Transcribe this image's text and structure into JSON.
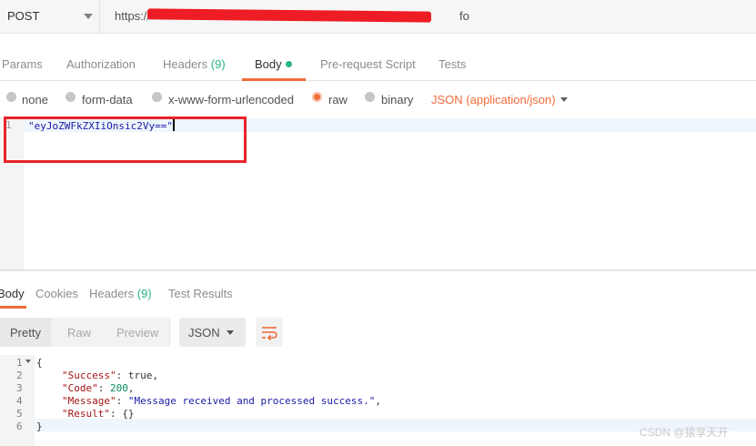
{
  "request": {
    "method": "POST",
    "url_visible": "https://",
    "url_tail": "fo"
  },
  "request_tabs": [
    {
      "label": "Params"
    },
    {
      "label": "Authorization"
    },
    {
      "label": "Headers",
      "count": "(9)"
    },
    {
      "label": "Body",
      "active": true
    },
    {
      "label": "Pre-request Script"
    },
    {
      "label": "Tests"
    }
  ],
  "body_options": {
    "none": "none",
    "form_data": "form-data",
    "urlencoded": "x-www-form-urlencoded",
    "raw": "raw",
    "binary": "binary",
    "selected": "raw",
    "content_type": "JSON (application/json)"
  },
  "request_body": {
    "line_number": "1",
    "text": "\"eyJoZWFkZXIiOnsic2Vy==\""
  },
  "response_tabs": [
    {
      "label": "Body",
      "active": true
    },
    {
      "label": "Cookies"
    },
    {
      "label": "Headers",
      "count": "(9)"
    },
    {
      "label": "Test Results"
    }
  ],
  "response_toolbar": {
    "pretty": "Pretty",
    "raw": "Raw",
    "preview": "Preview",
    "format": "JSON"
  },
  "response_body": {
    "line_numbers": [
      "1",
      "2",
      "3",
      "4",
      "5",
      "6"
    ],
    "open_brace": "{",
    "close_brace": "}",
    "fields": [
      {
        "key": "\"Success\"",
        "value": "true",
        "kind": "literal"
      },
      {
        "key": "\"Code\"",
        "value": "200",
        "kind": "number"
      },
      {
        "key": "\"Message\"",
        "value": "\"Message received and processed success.\"",
        "kind": "string"
      },
      {
        "key": "\"Result\"",
        "value": "{}",
        "kind": "literal"
      }
    ]
  },
  "watermark": "CSDN @猿享天开",
  "colors": {
    "accent": "#f26b3a",
    "count_green": "#26b47f",
    "annotation_red": "#e8232a"
  }
}
